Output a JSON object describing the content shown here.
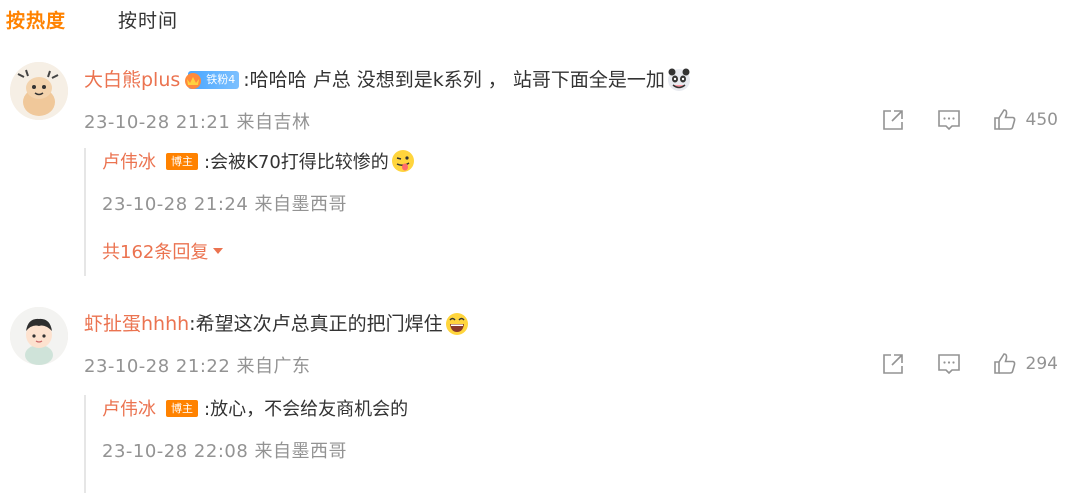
{
  "tabs": [
    {
      "label": "按热度",
      "active": true
    },
    {
      "label": "按时间",
      "active": false
    }
  ],
  "comments": [
    {
      "user": "大白熊plus",
      "fan_badge": "铁粉4",
      "text": ":哈哈哈 卢总 没想到是k系列 ， 站哥下面全是一加",
      "meta": "23-10-28 21:21 来自吉林",
      "likes": "450",
      "replies": [
        {
          "user": "卢伟冰",
          "badge": "博主",
          "text": ":会被K70打得比较惨的",
          "meta": "23-10-28 21:24 来自墨西哥"
        }
      ],
      "more_replies": "共162条回复"
    },
    {
      "user": "虾扯蛋hhhh",
      "text": ":希望这次卢总真正的把门焊住",
      "meta": "23-10-28 21:22 来自广东",
      "likes": "294",
      "replies": [
        {
          "user": "卢伟冰",
          "badge": "博主",
          "text": ":放心，不会给友商机会的",
          "meta": "23-10-28 22:08 来自墨西哥"
        }
      ]
    }
  ],
  "icons": {
    "share": "share-icon",
    "comment": "comment-icon",
    "like": "thumbs-up-icon"
  },
  "colors": {
    "accent": "#ff8200",
    "username": "#eb7350",
    "meta": "#939393",
    "fan_badge": "#49a6ff"
  }
}
